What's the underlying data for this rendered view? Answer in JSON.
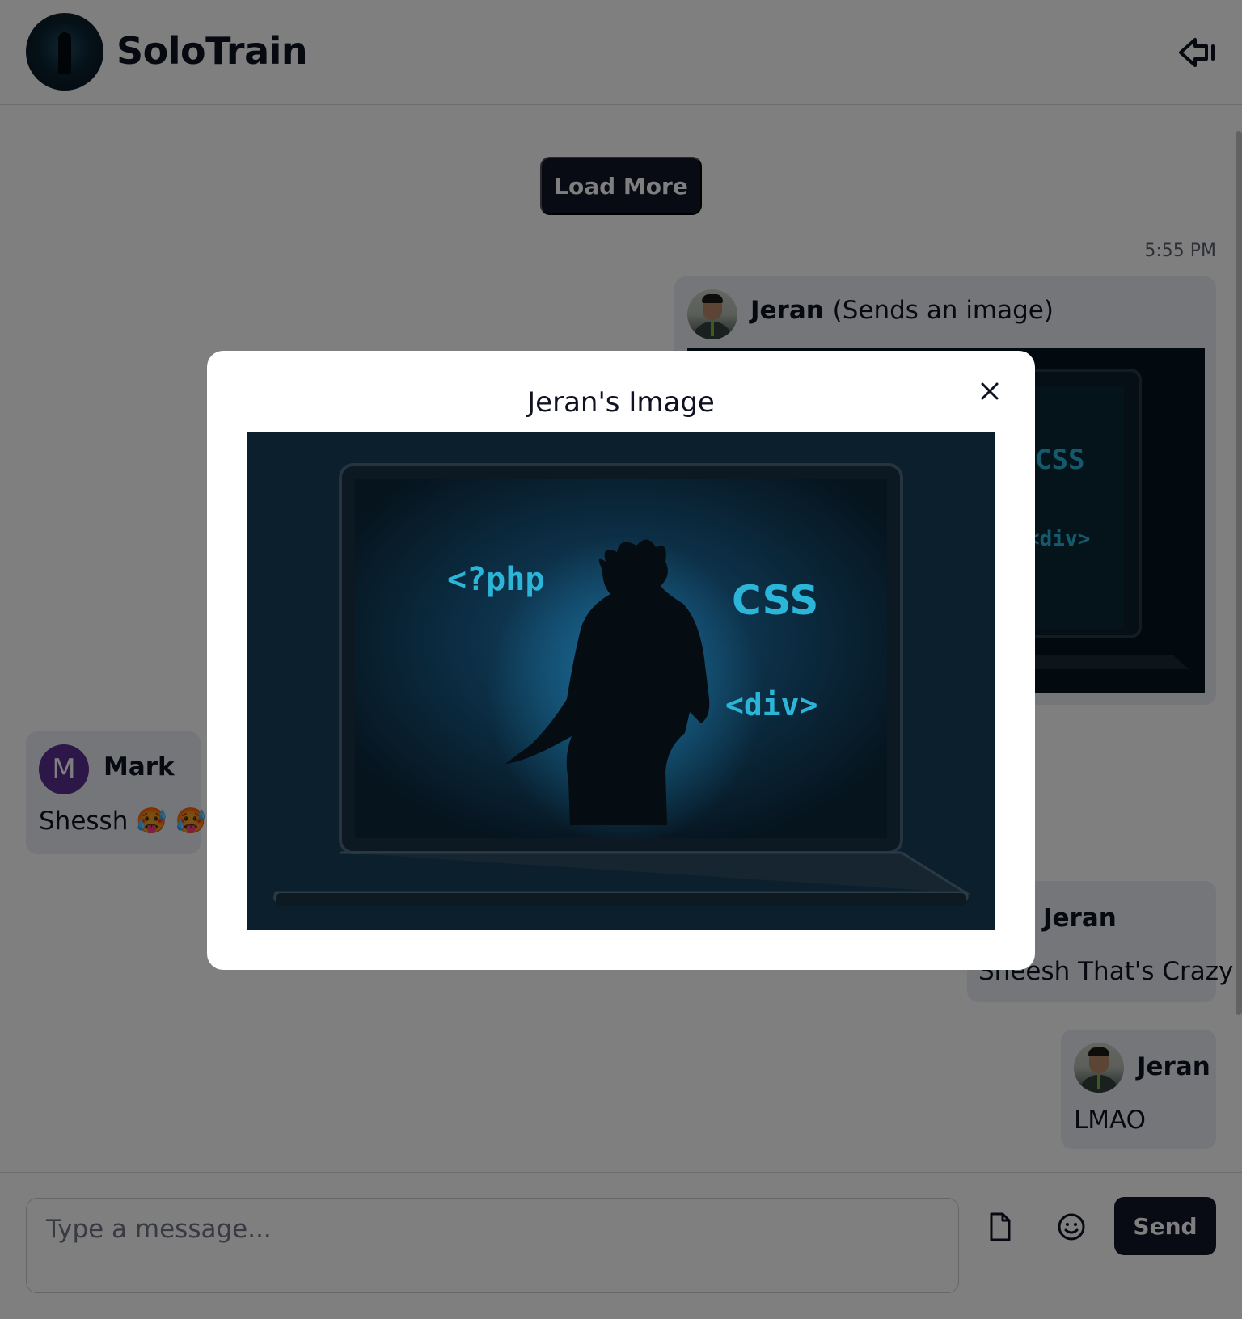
{
  "app": {
    "title": "SoloTrain"
  },
  "header": {
    "logo_icon": "app-logo-avatar",
    "logout_icon": "logout-arrow-icon"
  },
  "chat": {
    "load_more_label": "Load More",
    "timestamp": "5:55 PM",
    "messages": [
      {
        "sender": "Jeran",
        "note": "(Sends an image)",
        "type": "image",
        "image_text": {
          "php": "<?php",
          "css": "CSS",
          "div": "<div>"
        }
      },
      {
        "sender": "Mark",
        "avatar_letter": "M",
        "text": "Shessh 🥵 🥵"
      },
      {
        "sender": "Jeran",
        "text": "Sheesh That's Crazy"
      },
      {
        "sender": "Jeran",
        "text": "LMAO"
      }
    ]
  },
  "composer": {
    "placeholder": "Type a message...",
    "value": "",
    "send_label": "Send",
    "attach_icon": "file-icon",
    "emoji_icon": "smiley-icon"
  },
  "modal": {
    "title": "Jeran's Image",
    "close_icon": "close-icon",
    "image_text": {
      "php": "<?php",
      "css": "CSS",
      "div": "<div>"
    }
  },
  "colors": {
    "primary": "#121629",
    "bubble": "#eaedf3",
    "overlay": "rgba(0,0,0,0.5)",
    "code_text": "#2bb5d8",
    "avatar_mark": "#5a2d91"
  }
}
